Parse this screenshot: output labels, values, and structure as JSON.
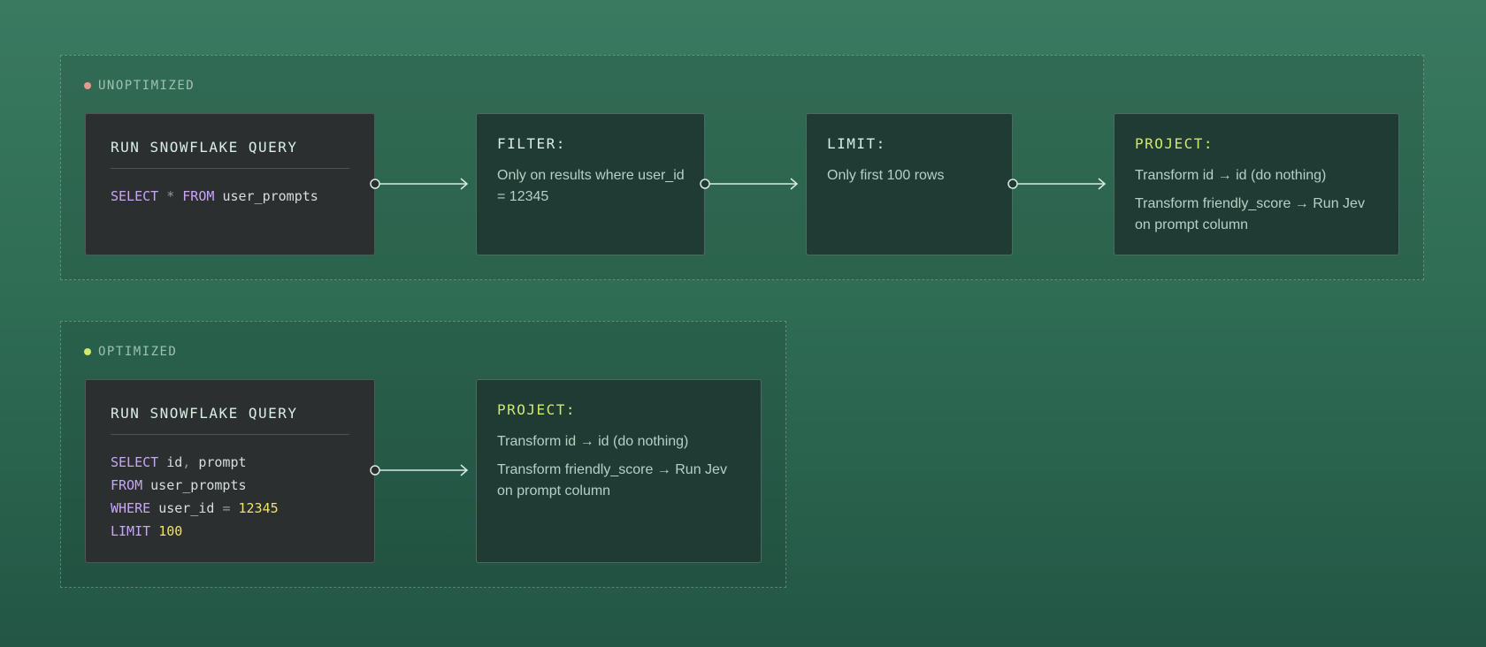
{
  "unoptimized": {
    "label": "UNOPTIMIZED",
    "dot_color": "#e8998a",
    "query": {
      "title": "RUN SNOWFLAKE QUERY",
      "code": {
        "kw1": "SELECT",
        "star": "*",
        "kw2": "FROM",
        "table": "user_prompts"
      }
    },
    "filter": {
      "title": "FILTER:",
      "text": "Only on results where user_id = 12345"
    },
    "limit": {
      "title": "LIMIT:",
      "text": "Only first 100 rows"
    },
    "project": {
      "title": "PROJECT:",
      "line1": "Transform id → id (do nothing)",
      "line2": "Transform friendly_score → Run Jev on prompt column"
    }
  },
  "optimized": {
    "label": "OPTIMIZED",
    "dot_color": "#cfe86d",
    "query": {
      "title": "RUN SNOWFLAKE QUERY",
      "code": {
        "select": "SELECT",
        "cols_a": "id",
        "comma": ",",
        "cols_b": "prompt",
        "from": "FROM",
        "table": "user_prompts",
        "where": "WHERE",
        "field": "user_id",
        "eq": "=",
        "value": "12345",
        "limit": "LIMIT",
        "limit_value": "100"
      }
    },
    "project": {
      "title": "PROJECT:",
      "line1": "Transform id → id (do nothing)",
      "line2": "Transform friendly_score → Run Jev on prompt column"
    }
  },
  "colors": {
    "connector": "#d7ebe1",
    "keyword": "#c9a6f5",
    "number": "#f0e26a",
    "project_title": "#cfe86d"
  }
}
